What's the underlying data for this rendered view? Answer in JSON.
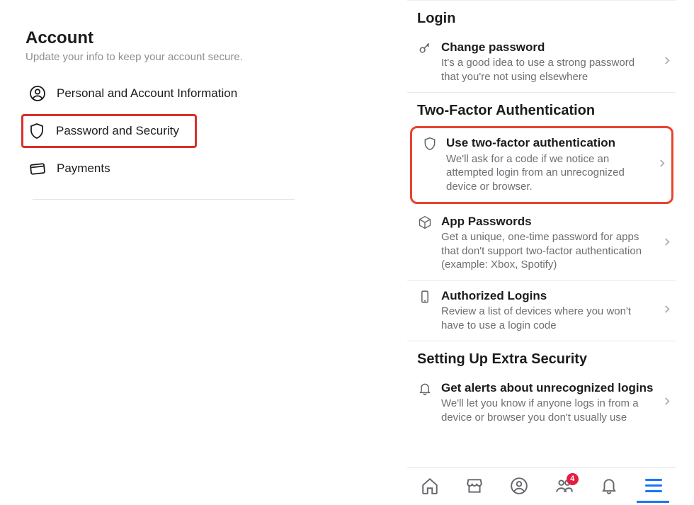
{
  "left": {
    "title": "Account",
    "subtitle": "Update your info to keep your account secure.",
    "items": [
      {
        "label": "Personal and Account Information"
      },
      {
        "label": "Password and Security"
      },
      {
        "label": "Payments"
      }
    ]
  },
  "right": {
    "sections": [
      {
        "title": "Login",
        "rows": [
          {
            "title": "Change password",
            "sub": "It's a good idea to use a strong password that you're not using elsewhere"
          }
        ]
      },
      {
        "title": "Two-Factor Authentication",
        "rows": [
          {
            "title": "Use two-factor authentication",
            "sub": "We'll ask for a code if we notice an attempted login from an unrecognized device or browser."
          },
          {
            "title": "App Passwords",
            "sub": "Get a unique, one-time password for apps that don't support two-factor authentication (example: Xbox, Spotify)"
          },
          {
            "title": "Authorized Logins",
            "sub": "Review a list of devices where you won't have to use a login code"
          }
        ]
      },
      {
        "title": "Setting Up Extra Security",
        "rows": [
          {
            "title": "Get alerts about unrecognized logins",
            "sub": "We'll let you know if anyone logs in from a device or browser you don't usually use"
          }
        ]
      }
    ]
  },
  "nav": {
    "badge_count": "4"
  }
}
